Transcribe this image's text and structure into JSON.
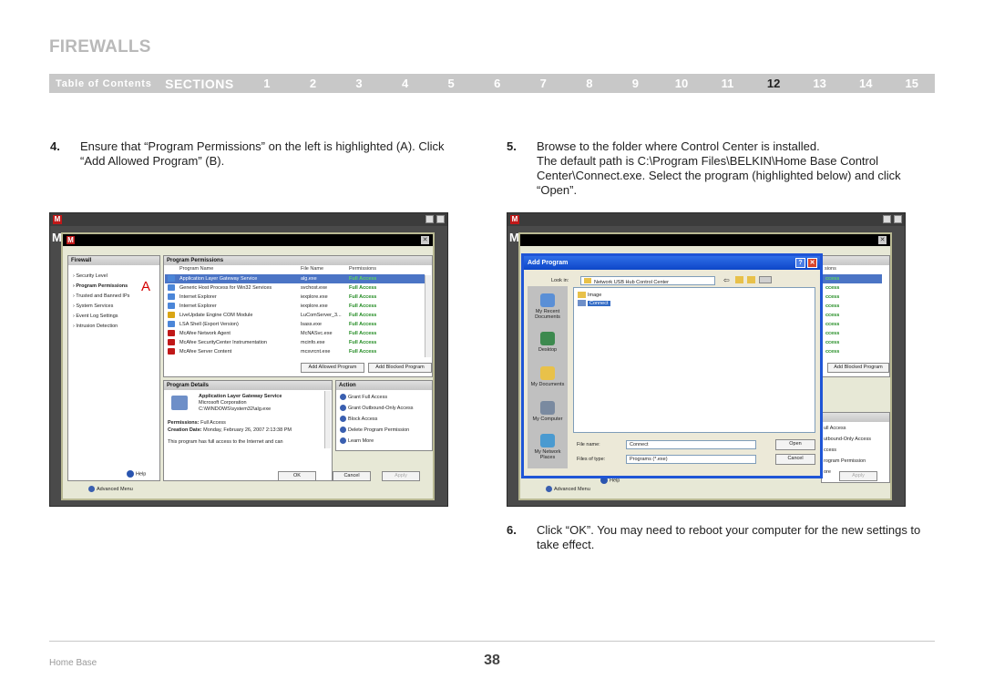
{
  "header": {
    "title": "FIREWALLS"
  },
  "nav": {
    "toc": "Table of Contents",
    "sections": "SECTIONS",
    "numbers": [
      "1",
      "2",
      "3",
      "4",
      "5",
      "6",
      "7",
      "8",
      "9",
      "10",
      "11",
      "12",
      "13",
      "14",
      "15"
    ],
    "active": "12"
  },
  "steps": {
    "s4": {
      "num": "4.",
      "text": "Ensure that “Program Permissions” on the left is highlighted (A). Click “Add Allowed Program” (B)."
    },
    "s5": {
      "num": "5.",
      "line1": "Browse to the folder where Control Center is installed.",
      "line2": "The default path is C:\\Program Files\\BELKIN\\Home Base Control Center\\Connect.exe. Select the program (highlighted below) and click “Open”."
    },
    "s6": {
      "num": "6.",
      "text": "Click “OK”. You may need to reboot your computer for the new settings to take effect."
    }
  },
  "shot1": {
    "firewall_head": "Firewall",
    "side_items": [
      "Security Level",
      "Program Permissions",
      "Trusted and Banned IPs",
      "System Services",
      "Event Log Settings",
      "Intrusion Detection"
    ],
    "perm_head": "Program Permissions",
    "cols": {
      "name": "Program Name",
      "file": "File Name",
      "perm": "Permissions"
    },
    "rows": [
      {
        "name": "Application Layer Gateway Service",
        "file": "alg.exe",
        "perm": "Full Access"
      },
      {
        "name": "Generic Host Process for Win32 Services",
        "file": "svchost.exe",
        "perm": "Full Access"
      },
      {
        "name": "Internet Explorer",
        "file": "iexplore.exe",
        "perm": "Full Access"
      },
      {
        "name": "Internet Explorer",
        "file": "iexplore.exe",
        "perm": "Full Access"
      },
      {
        "name": "LiveUpdate Engine COM Module",
        "file": "LuComServer_3...",
        "perm": "Full Access"
      },
      {
        "name": "LSA Shell (Export Version)",
        "file": "lsass.exe",
        "perm": "Full Access"
      },
      {
        "name": "McAfee Network Agent",
        "file": "McNASvc.exe",
        "perm": "Full Access"
      },
      {
        "name": "McAfee SecurityCenter Instrumentation",
        "file": "mcinfo.exe",
        "perm": "Full Access"
      },
      {
        "name": "McAfee Server Content",
        "file": "mcsvrcnt.exe",
        "perm": "Full Access"
      }
    ],
    "add_allowed": "Add Allowed Program",
    "add_blocked": "Add Blocked Program",
    "details_head": "Program Details",
    "detail_name": "Application Layer Gateway Service",
    "detail_company": "Microsoft Corporation",
    "detail_path": "C:\\WINDOWS\\system32\\alg.exe",
    "perm_label": "Permissions:",
    "perm_value": "Full Access",
    "created_label": "Creation Date:",
    "created_value": "Monday, February 26, 2007 2:13:38 PM",
    "note": "This program has full access to the Internet and can",
    "action_head": "Action",
    "actions": [
      "Grant Full Access",
      "Grant Outbound-Only Access",
      "Block Access",
      "Delete Program Permission",
      "Learn More"
    ],
    "help": "Help",
    "ok": "OK",
    "cancel": "Cancel",
    "apply": "Apply",
    "advanced": "Advanced Menu",
    "marker_a": "A",
    "marker_b": "B"
  },
  "shot2": {
    "title": "Add Program",
    "look_in_label": "Look in:",
    "look_in_value": "Network USB Hub Control Center",
    "files": [
      "Image",
      "Connect"
    ],
    "places": [
      "My Recent Documents",
      "Desktop",
      "My Documents",
      "My Computer",
      "My Network Places"
    ],
    "file_name_label": "File name:",
    "file_name_value": "Connect",
    "file_type_label": "Files of type:",
    "file_type_value": "Programs (*.exe)",
    "open": "Open",
    "cancel": "Cancel",
    "bg_col_head": "sions",
    "bg_cells": [
      "ccess",
      "ccess",
      "ccess",
      "ccess",
      "ccess",
      "ccess",
      "ccess",
      "ccess",
      "ccess"
    ],
    "bg_add_blocked": "Add Blocked Program",
    "bg_actions": [
      "ull Access",
      "utbound-Only Access",
      "ccess",
      "rogram Permission",
      "ore"
    ],
    "help": "Help",
    "apply": "Apply",
    "advanced": "Advanced Menu"
  },
  "footer": {
    "left": "Home Base",
    "page": "38"
  }
}
